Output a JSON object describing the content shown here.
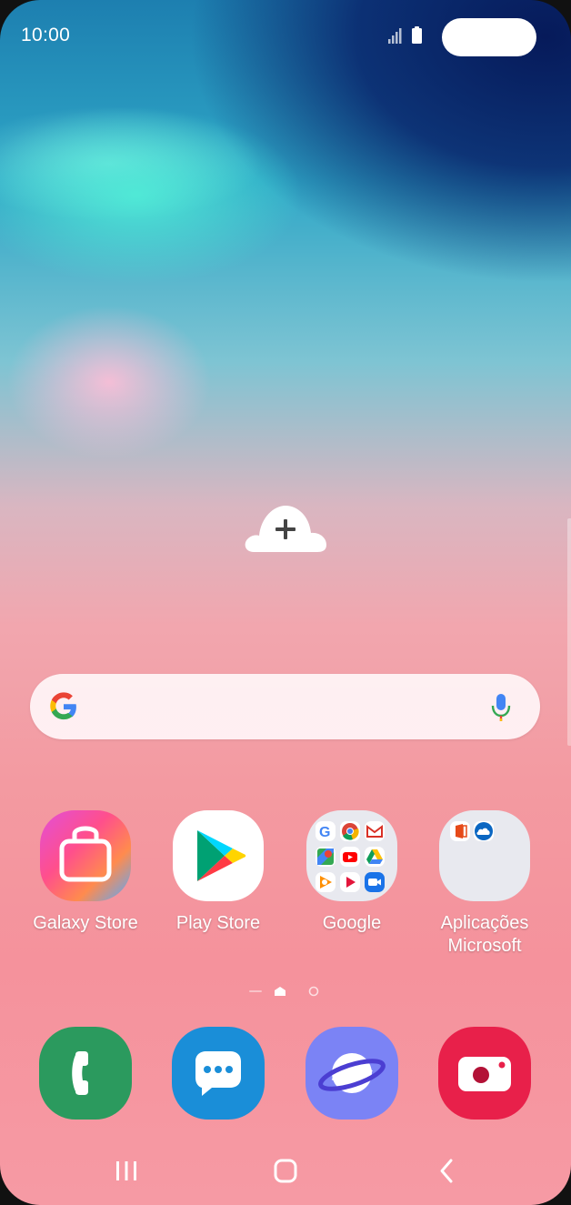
{
  "status_bar": {
    "time": "10:00"
  },
  "home": {
    "apps": [
      {
        "label": "Galaxy Store"
      },
      {
        "label": "Play Store"
      },
      {
        "label": "Google"
      },
      {
        "label": "Aplicações\nMicrosoft"
      }
    ],
    "page_indicator": {
      "pages": 2,
      "current": 1
    }
  },
  "dock": [
    {
      "icon": "phone-icon"
    },
    {
      "icon": "messages-icon"
    },
    {
      "icon": "internet-icon"
    },
    {
      "icon": "camera-icon"
    }
  ],
  "nav": {
    "buttons": [
      "recents",
      "home",
      "back"
    ]
  },
  "colors": {
    "phone": "#2b9a5e",
    "messages": "#1a8ed8",
    "internet": "#7b83f5",
    "camera": "#e8204a"
  }
}
